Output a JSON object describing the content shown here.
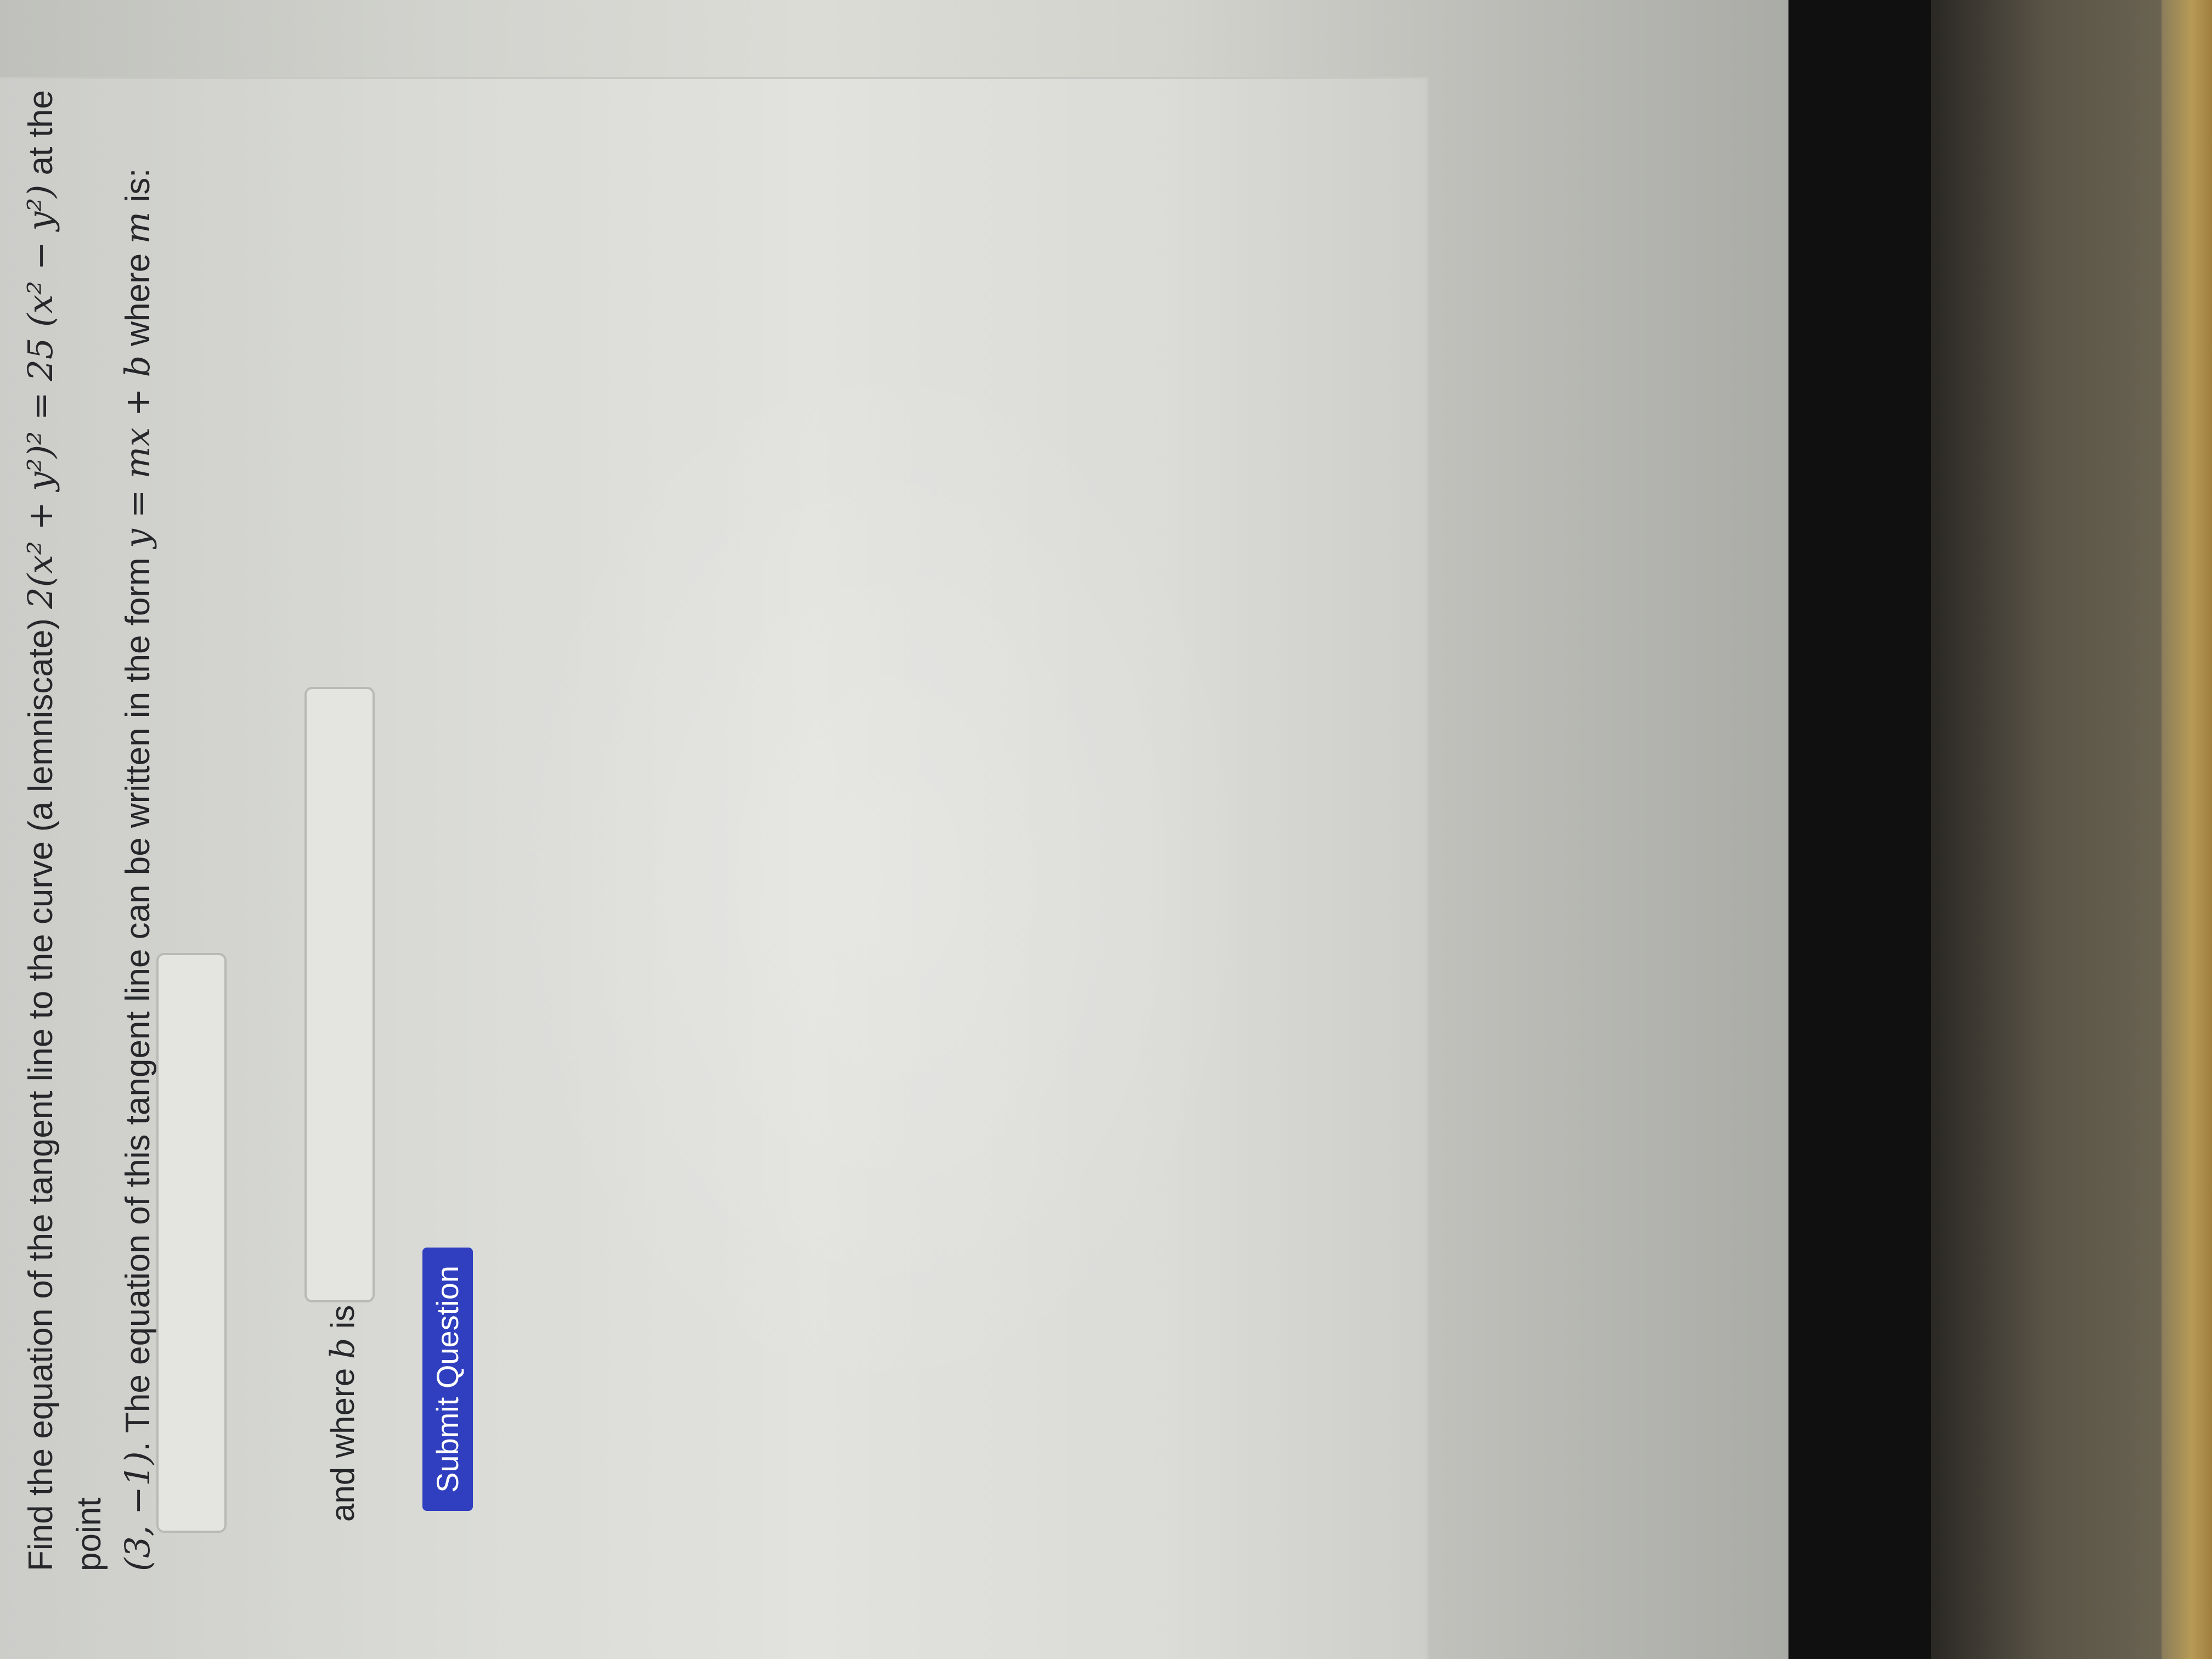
{
  "question": {
    "line1_prefix": "Find the equation of the tangent line to the curve (a lemniscate) ",
    "equation": "2(x² + y²)² = 25 (x² − y²)",
    "line1_suffix": " at the point",
    "point": "(3, −1)",
    "line2_text": ". The equation of this tangent line can be written in the form ",
    "form": "y = mx + b",
    "line2_suffix": " where ",
    "m_symbol": "m",
    "line2_end": " is:"
  },
  "answer_m": {
    "value": ""
  },
  "answer_b": {
    "label_prefix": "and where ",
    "b_symbol": "b",
    "label_suffix": " is:",
    "value": ""
  },
  "submit": {
    "label": "Submit Question",
    "color": "#2f3fbf"
  }
}
